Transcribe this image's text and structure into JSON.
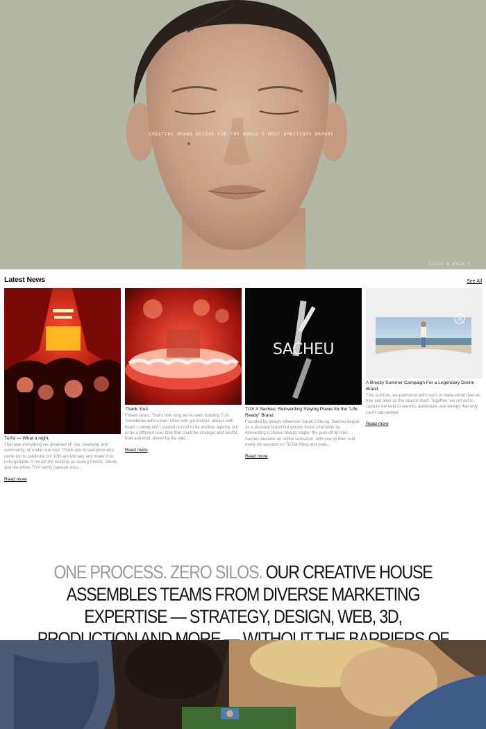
{
  "hero": {
    "tagline": "CREATING BRAND DESIRE FOR THE WORLD'S MOST AMBITIOUS BRANDS.",
    "cta_label": "CLICK N HOLD ®",
    "background_color": "#b3b8a6"
  },
  "news": {
    "heading": "Latest News",
    "see_all_label": "See All",
    "cards": [
      {
        "title": "TuXV — What a night.",
        "text": "That was everything we dreamed of! Joy, creativity, and community, all under one roof. Thank you to everyone who came out to celebrate our 15th anniversary and made it so unforgettable. It meant the world to us seeing friends, clients, and the whole TUX family (special shou...",
        "read_more": "Read more"
      },
      {
        "title": "Thank You!",
        "text": "Fifteen years. That's how long we've been building TUX. Sometimes with a plan, often with gut instinct, always with heart. Ludwig and I started out not to be another agency, but to be a different one. One that could be strategic and soulful, bold and kind, driven by the wild...",
        "read_more": "Read more"
      },
      {
        "title": "TUX X Sacheu: Reinventing Staying Power for the \"Life Ready\" Brand",
        "text": "Founded by beauty influencer Sarah Cheung, Sacheu began as a skincare brand but quickly found viral fame by reinventing a classic beauty staple: the peel-off lip liner. Sacheu became an online sensation, with one lip liner sold every six seconds on TikTok Shop and prais...",
        "read_more": "Read more",
        "image_text": "SACHEU"
      },
      {
        "title": "A Breezy Summer Campaign For a Legendary Denim Brand",
        "text": "This summer, we partnered with Levi's to make denim feel as free and alive as the season itself. Together, we set out to capture the kind of warmth, adventure, and energy that only Levi's can deliver.",
        "read_more": "Read more",
        "image_mark": "®"
      }
    ]
  },
  "statement": {
    "lead": "ONE PROCESS. ZERO SILOS.",
    "body": "OUR CREATIVE HOUSE ASSEMBLES TEAMS FROM DIVERSE MARKETING EXPERTISE — STRATEGY, DESIGN, WEB, 3D, PRODUCTION AND MORE — WITHOUT THE BARRIERS OF SILOS."
  }
}
